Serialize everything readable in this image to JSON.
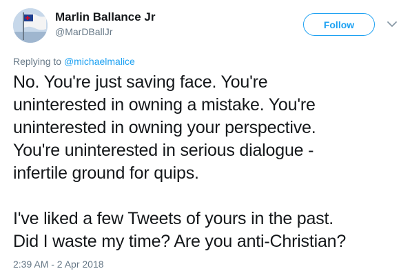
{
  "author": {
    "name": "Marlin Ballance Jr",
    "handle": "@MarDBallJr",
    "avatar_icon": "flag-avatar-icon"
  },
  "actions": {
    "follow_label": "Follow",
    "more_icon": "chevron-down-icon"
  },
  "reply": {
    "prefix": "Replying to ",
    "mention": "@michaelmalice"
  },
  "tweet": {
    "paragraph1": [
      "No. You're just saving face. You're",
      "uninterested in owning a mistake. You're",
      "uninterested in owning your perspective.",
      "You're uninterested in serious dialogue -",
      "infertile ground for quips."
    ],
    "paragraph2": [
      "I've liked a few Tweets of yours in the past.",
      "Did I waste my time? Are you anti-Christian?"
    ]
  },
  "timestamp": "2:39 AM - 2 Apr 2018",
  "colors": {
    "accent": "#1da1f2",
    "text": "#14171a",
    "secondary": "#657786"
  }
}
